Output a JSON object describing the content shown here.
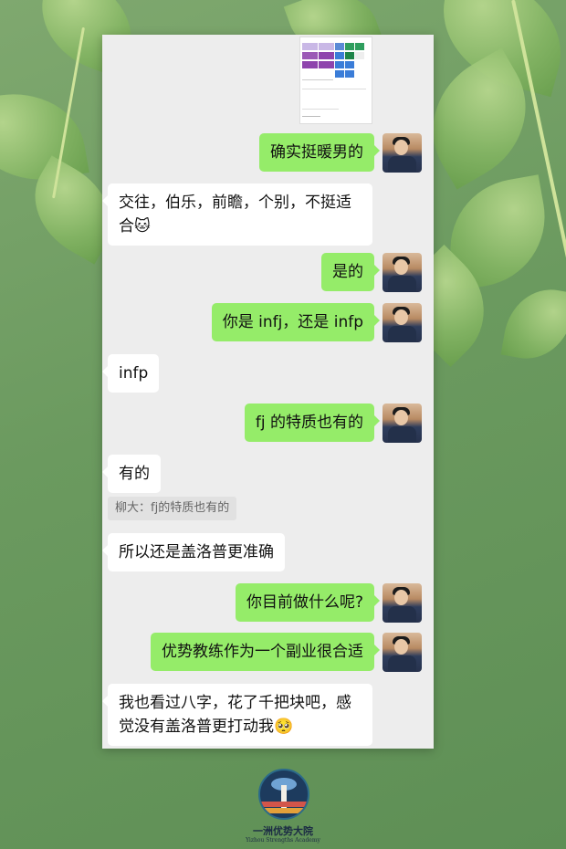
{
  "messages": [
    {
      "side": "me",
      "text": "确实挺暖男的"
    },
    {
      "side": "them",
      "text": "交往，伯乐，前瞻，个别，不挺适\n合🐱"
    },
    {
      "side": "me",
      "text": "是的"
    },
    {
      "side": "me",
      "text": "你是 infj，还是 infp"
    },
    {
      "side": "them",
      "text": "infp"
    },
    {
      "side": "me",
      "text": "fj 的特质也有的"
    },
    {
      "side": "them",
      "text": "有的"
    },
    {
      "side": "them",
      "text": "所以还是盖洛普更准确"
    },
    {
      "side": "me",
      "text": "你目前做什么呢?"
    },
    {
      "side": "me",
      "text": "优势教练作为一个副业很合适"
    },
    {
      "side": "them",
      "text": "我也看过八字，花了千把块吧，感\n觉没有盖洛普更打动我🥺"
    }
  ],
  "quote": "柳大：fj的特质也有的",
  "logo": {
    "name": "一洲优势大院",
    "subtitle": "Yizhou Strengths Academy"
  },
  "colors": {
    "my_bubble": "#95ec69",
    "their_bubble": "#ffffff",
    "chat_background": "#ededed"
  }
}
